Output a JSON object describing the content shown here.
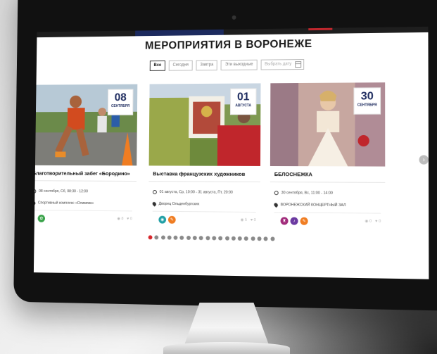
{
  "page": {
    "title": "МЕРОПРИЯТИЯ В ВОРОНЕЖЕ"
  },
  "filters": {
    "all": "Все",
    "today": "Сегодня",
    "tomorrow": "Завтра",
    "weekend": "Эти выходные",
    "date_placeholder": "Выбрать дату"
  },
  "events": [
    {
      "day": "08",
      "month": "сентября",
      "title": "Благотворительный забег «Бородино»",
      "when": "08 сентября, Сб, 08:30 - 12:00",
      "where": "Спортивный комплекс «Олимпик»",
      "views": "8",
      "likes": "0",
      "tags": [
        "sport-icon"
      ],
      "tag_colors": [
        "#3aa34a"
      ]
    },
    {
      "day": "01",
      "month": "августа",
      "title": "Выставка французских художников",
      "when": "01 августа, Ср, 10:00 - 31 августа, Пт, 20:00",
      "where": "Дворец Ольденбургских",
      "views": "5",
      "likes": "0",
      "tags": [
        "eye-icon",
        "palette-icon"
      ],
      "tag_colors": [
        "#21a0a6",
        "#f07d22"
      ]
    },
    {
      "day": "30",
      "month": "сентября",
      "title": "БЕЛОСНЕЖКА",
      "when": "30 сентября, Вс, 11:00 - 14:00",
      "where": "ВОРОНЕЖСКИЙ КОНЦЕРТНЫЙ ЗАЛ",
      "views": "0",
      "likes": "0",
      "tags": [
        "theatre-icon",
        "dance-icon",
        "palette-icon"
      ],
      "tag_colors": [
        "#a12c7b",
        "#6b3aa1",
        "#f07d22"
      ]
    }
  ],
  "pagination": {
    "total": 20,
    "active_index": 0,
    "active_color": "#d7262c"
  },
  "colors": {
    "accent_navy": "#1c2a5e",
    "accent_red": "#c0272d"
  }
}
